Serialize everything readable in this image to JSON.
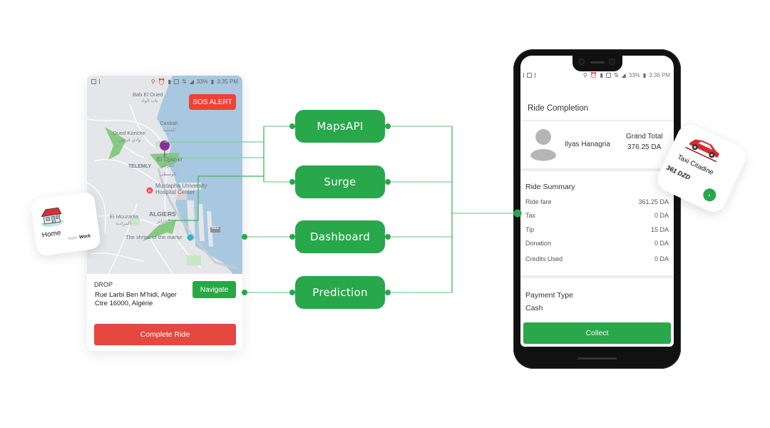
{
  "colors": {
    "accent_green": "#28a74b",
    "connector_green": "#7fcf93",
    "alert_red": "#ef4134",
    "complete_red": "#e4483f",
    "map_water": "#a7c8e0",
    "map_land": "#e4e6e9",
    "map_park": "#7cc576",
    "pin_purple": "#8a2e9e"
  },
  "left_phone": {
    "status_bar": {
      "left_icons": [
        "image-icon",
        "alert-icon"
      ],
      "right_icons": [
        "location-icon",
        "alarm-icon",
        "sim-icon",
        "signal-box-icon",
        "data-icon",
        "signal-icon"
      ],
      "battery": "33%",
      "time": "3:35 PM"
    },
    "sos_button": "SOS ALERT",
    "map_labels": {
      "bab_el_oued": "Bab El Oued",
      "bab_el_oued_ar": "باب الواد",
      "casbah": "Casbah",
      "casbah_ar": "القصبة",
      "oued_koriche": "Oued Koriche",
      "oued_koriche_ar": "وادي قريش",
      "el_djazair": "El Djazair",
      "el_djazair_ar": "الجزائر",
      "wast": "الوسطى",
      "telemly": "TELEMLY",
      "hospital": "Mustapha University",
      "hospital_line2": "Hospital Center",
      "el_mouradia": "El Mouradia",
      "el_mouradia_ar": "المرادية",
      "algiers": "ALGIERS",
      "algiers_ar": "الجزائر",
      "shrine": "The shrine of the martyr",
      "road": "N11"
    },
    "drop": {
      "title": "DROP",
      "address_line1": "Rue Larbi Ben M'hidi, Alger",
      "address_line2": "Ctre 16000, Algérie"
    },
    "navigate_button": "Navigate",
    "complete_button": "Complete Ride"
  },
  "home_card": {
    "icon": "house-icon",
    "label": "Home",
    "from_prefix": "from:",
    "from_value": "Work"
  },
  "nodes": [
    {
      "label": "MapsAPI"
    },
    {
      "label": "Surge"
    },
    {
      "label": "Dashboard"
    },
    {
      "label": "Prediction"
    }
  ],
  "right_phone": {
    "status_bar": {
      "left_icons": [
        "alert-icon",
        "image-icon",
        "alert-icon"
      ],
      "right_icons": [
        "location-icon",
        "alarm-icon",
        "sim-icon",
        "signal-box-icon",
        "data-icon",
        "signal-icon"
      ],
      "battery": "33%",
      "time": "3:36 PM"
    },
    "title": "Ride Completion",
    "driver_name": "Ilyas Hanagria",
    "grand_total_label": "Grand Total",
    "grand_total_value": "376.25 DA",
    "summary_title": "Ride Summary",
    "summary_rows": [
      {
        "label": "Ride fare",
        "value": "361.25 DA"
      },
      {
        "label": "Tax",
        "value": "0 DA"
      },
      {
        "label": "Tip",
        "value": "15 DA"
      },
      {
        "label": "Donation",
        "value": "0 DA"
      },
      {
        "label": "Credits Used",
        "value": "0 DA"
      }
    ],
    "payment_label": "Payment Type",
    "payment_value": "Cash",
    "collect_button": "Collect"
  },
  "taxi_card": {
    "icon": "car-icon",
    "name": "Taxi Citadine",
    "price": "361 DZD",
    "go_icon": "chevron-right-icon"
  }
}
